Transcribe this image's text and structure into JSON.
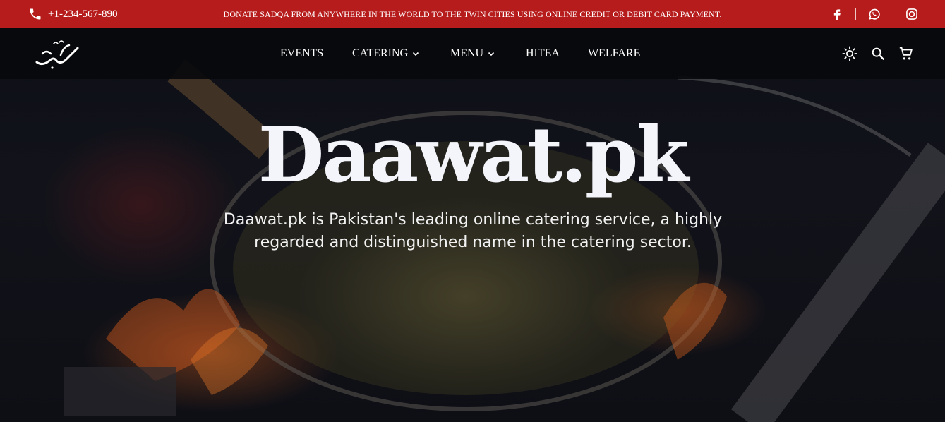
{
  "topbar": {
    "phone": "+1-234-567-890",
    "notice": "DONATE SADQA FROM ANYWHERE IN THE WORLD TO THE TWIN CITIES USING ONLINE CREDIT OR DEBIT CARD PAYMENT.",
    "social": [
      "facebook-icon",
      "whatsapp-icon",
      "instagram-icon"
    ]
  },
  "nav": {
    "items": [
      {
        "label": "EVENTS",
        "dropdown": false
      },
      {
        "label": "CATERING",
        "dropdown": true
      },
      {
        "label": "MENU",
        "dropdown": true
      },
      {
        "label": "HITEA",
        "dropdown": false
      },
      {
        "label": "WELFARE",
        "dropdown": false
      }
    ],
    "icons": [
      "theme-toggle-icon",
      "search-icon",
      "cart-icon"
    ]
  },
  "hero": {
    "title": "Daawat.pk",
    "description": "Daawat.pk is Pakistan's leading online catering service, a highly regarded and distinguished name in the catering sector."
  },
  "colors": {
    "topbar": "#b71c1c",
    "navbar": "#08090c",
    "hero_text": "#f3f5fb"
  }
}
